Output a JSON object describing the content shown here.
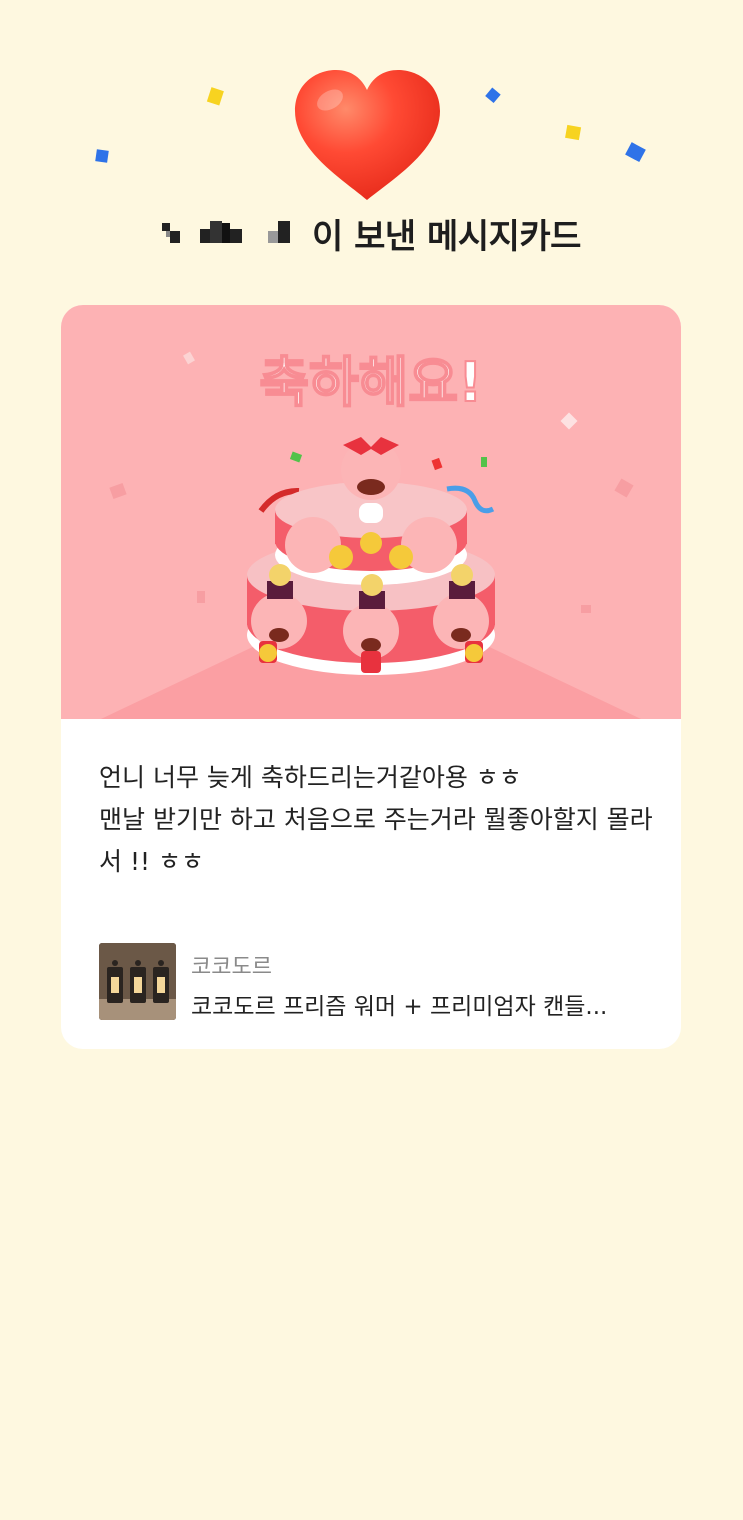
{
  "header": {
    "sender_suffix": "이 보낸 메시지카드"
  },
  "card": {
    "banner_text": "축하해요!",
    "message": "언니 너무 늦게 축하드리는거같아용 ㅎㅎ\n맨날 받기만 하고 처음으로 주는거라 뭘좋아할지 몰라\n   서 !! ㅎㅎ"
  },
  "gift": {
    "brand": "코코도르",
    "name": "코코도르 프리즘 워머 + 프리미엄자 캔들..."
  },
  "colors": {
    "background": "#fef8e0",
    "card_art_bg": "#fdb2b4",
    "heart": "#ff4d3a",
    "confetti_yellow": "#f7d320",
    "confetti_blue": "#2f73e8"
  }
}
